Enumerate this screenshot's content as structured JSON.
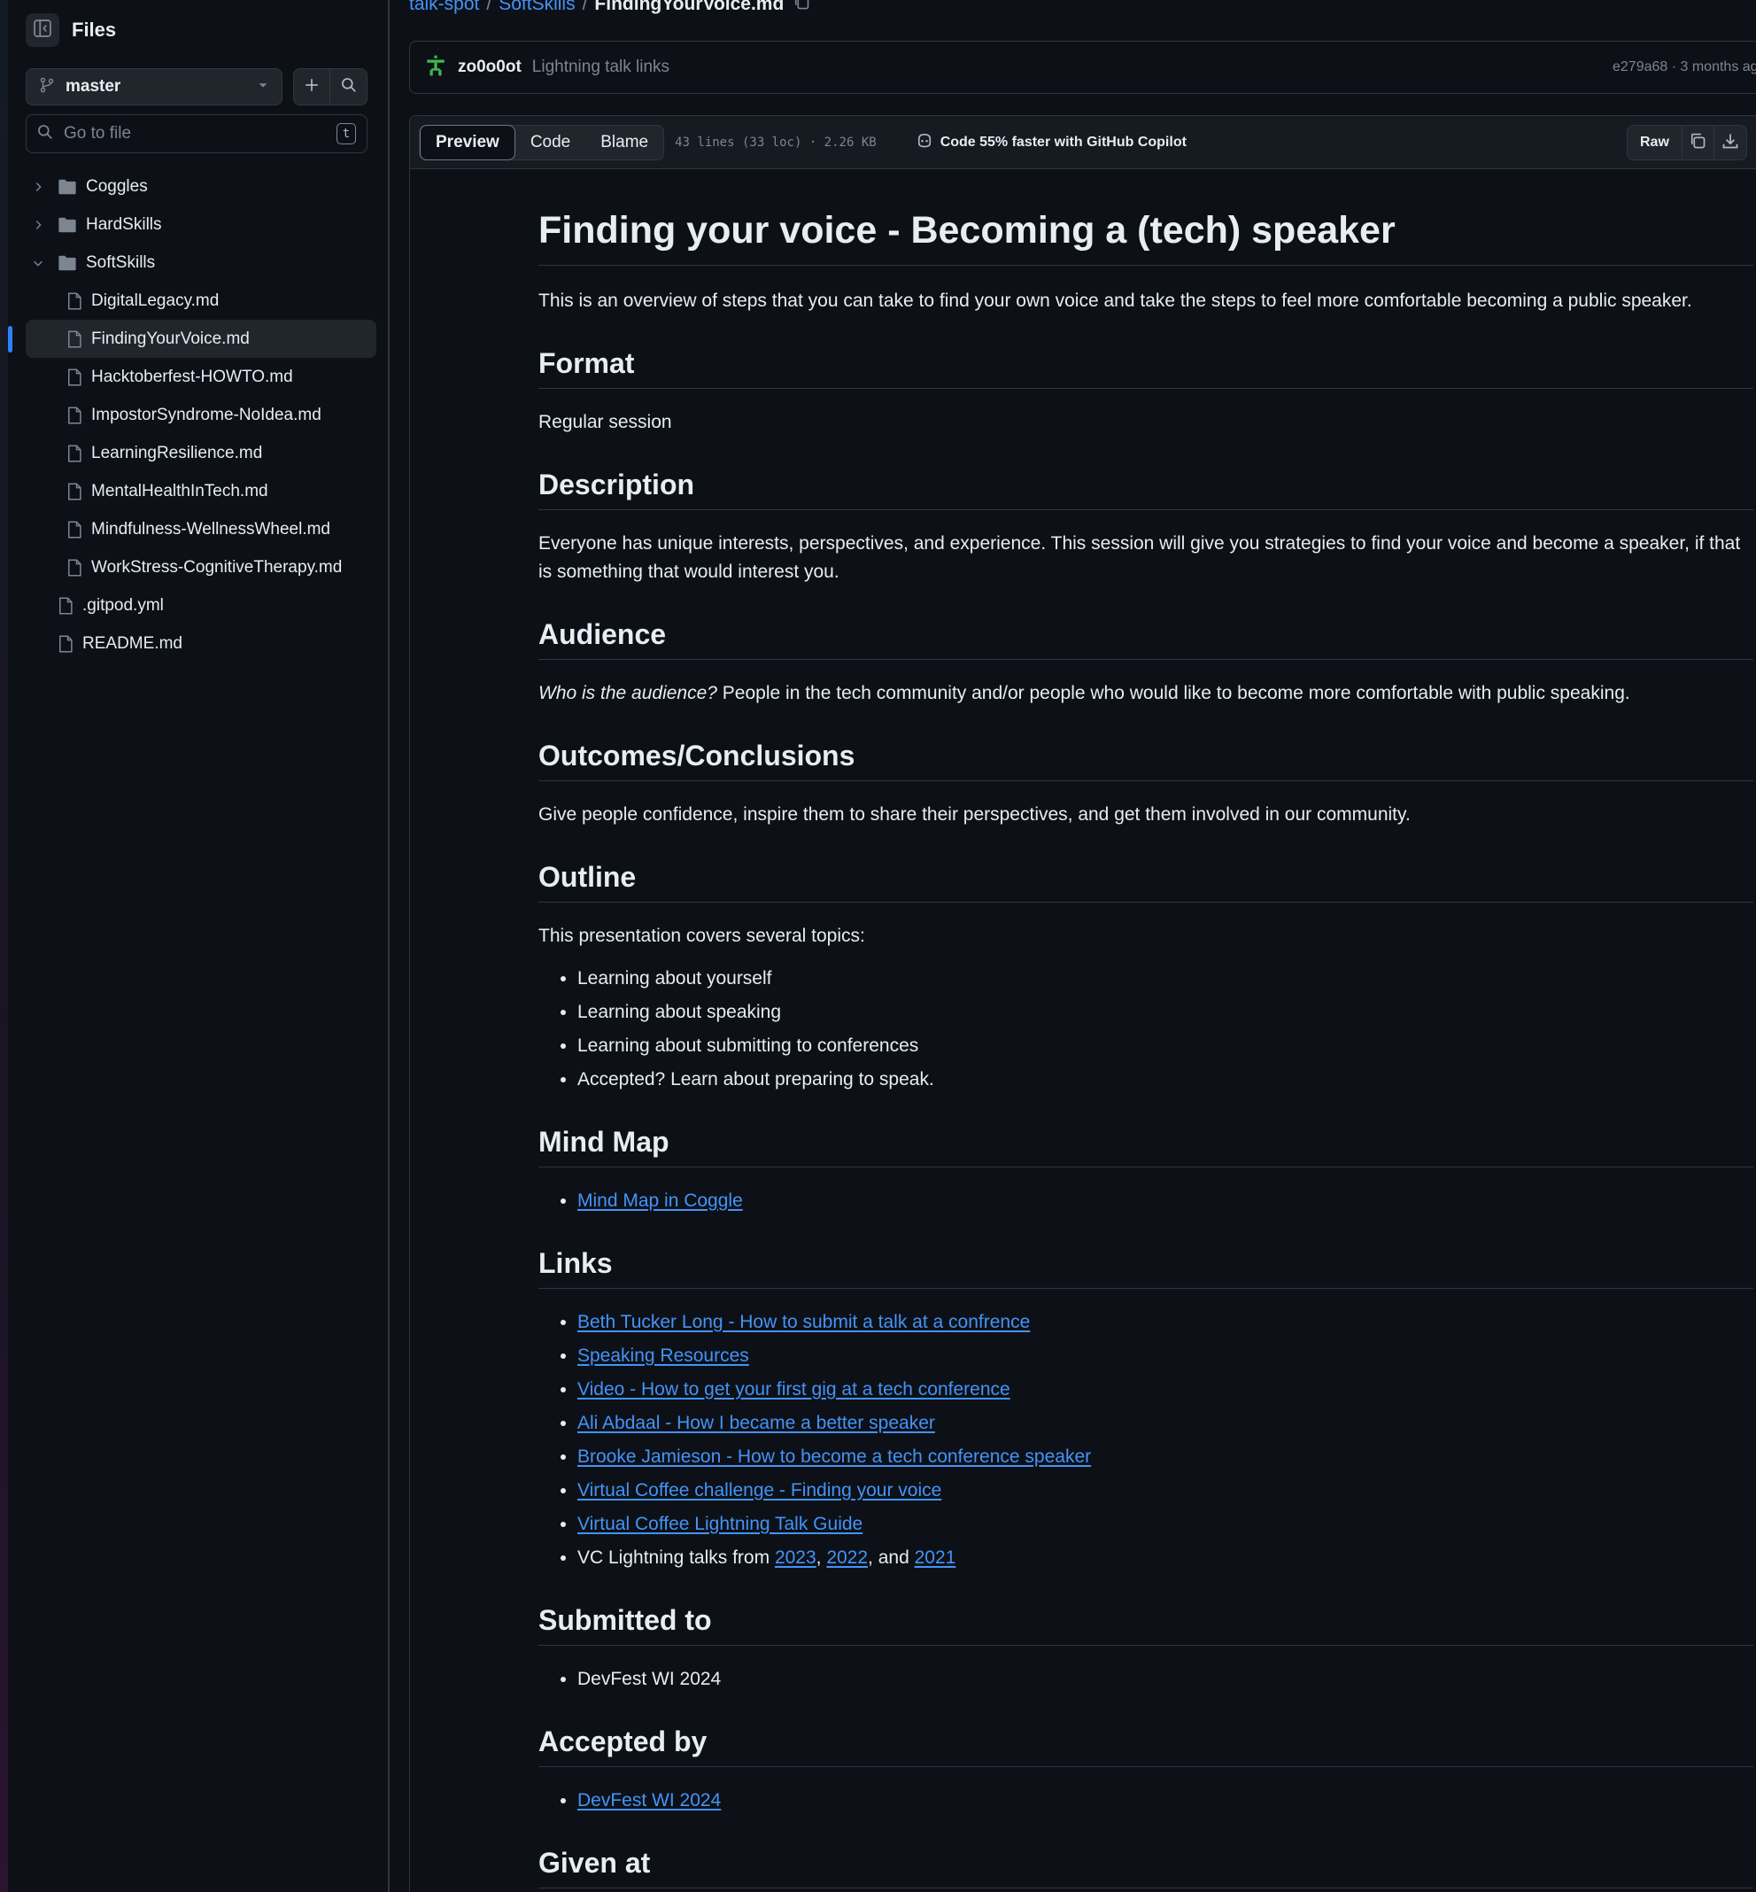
{
  "sidebar": {
    "title": "Files",
    "branch": "master",
    "goto_placeholder": "Go to file",
    "goto_shortcut": "t",
    "tree": [
      {
        "name": "Coggles",
        "type": "folder",
        "expanded": false,
        "level": 0
      },
      {
        "name": "HardSkills",
        "type": "folder",
        "expanded": false,
        "level": 0
      },
      {
        "name": "SoftSkills",
        "type": "folder",
        "expanded": true,
        "level": 0
      },
      {
        "name": "DigitalLegacy.md",
        "type": "file",
        "level": 1
      },
      {
        "name": "FindingYourVoice.md",
        "type": "file",
        "level": 1,
        "active": true
      },
      {
        "name": "Hacktoberfest-HOWTO.md",
        "type": "file",
        "level": 1
      },
      {
        "name": "ImpostorSyndrome-NoIdea.md",
        "type": "file",
        "level": 1
      },
      {
        "name": "LearningResilience.md",
        "type": "file",
        "level": 1
      },
      {
        "name": "MentalHealthInTech.md",
        "type": "file",
        "level": 1
      },
      {
        "name": "Mindfulness-WellnessWheel.md",
        "type": "file",
        "level": 1
      },
      {
        "name": "WorkStress-CognitiveTherapy.md",
        "type": "file",
        "level": 1
      },
      {
        "name": ".gitpod.yml",
        "type": "file",
        "level": 0
      },
      {
        "name": "README.md",
        "type": "file",
        "level": 0
      }
    ]
  },
  "breadcrumb": {
    "repo": "talk-spot",
    "folder": "SoftSkills",
    "file": "FindingYourVoice.md",
    "sep": "/"
  },
  "commit": {
    "author": "zo0o0ot",
    "message": "Lightning talk links",
    "meta": "e279a68 · 3 months ag"
  },
  "file_header": {
    "tabs": [
      "Preview",
      "Code",
      "Blame"
    ],
    "info": "43 lines (33 loc) · 2.26 KB",
    "copilot": "Code 55% faster with GitHub Copilot",
    "raw": "Raw"
  },
  "doc": {
    "title": "Finding your voice - Becoming a (tech) speaker",
    "intro": "This is an overview of steps that you can take to find your own voice and take the steps to feel more comfortable becoming a public speaker.",
    "format": {
      "heading": "Format",
      "text": "Regular session"
    },
    "description": {
      "heading": "Description",
      "text": "Everyone has unique interests, perspectives, and experience. This session will give you strategies to find your voice and become a speaker, if that is something that would interest you."
    },
    "audience": {
      "heading": "Audience",
      "question": "Who is the audience?",
      "text": " People in the tech community and/or people who would like to become more comfortable with public speaking."
    },
    "outcomes": {
      "heading": "Outcomes/Conclusions",
      "text": "Give people confidence, inspire them to share their perspectives, and get them involved in our community."
    },
    "outline": {
      "heading": "Outline",
      "text": "This presentation covers several topics:",
      "items": [
        "Learning about yourself",
        "Learning about speaking",
        "Learning about submitting to conferences",
        "Accepted? Learn about preparing to speak."
      ]
    },
    "mindmap": {
      "heading": "Mind Map",
      "link": "Mind Map in Coggle"
    },
    "links": {
      "heading": "Links",
      "items": [
        "Beth Tucker Long - How to submit a talk at a confrence",
        "Speaking Resources",
        "Video - How to get your first gig at a tech conference",
        "Ali Abdaal - How I became a better speaker",
        "Brooke Jamieson - How to become a tech conference speaker",
        "Virtual Coffee challenge - Finding your voice",
        "Virtual Coffee Lightning Talk Guide"
      ],
      "vc_prefix": "VC Lightning talks from ",
      "vc_2023": "2023",
      "vc_comma": ", ",
      "vc_2022": "2022",
      "vc_and": ", and ",
      "vc_2021": "2021"
    },
    "submitted": {
      "heading": "Submitted to",
      "items": [
        "DevFest WI 2024"
      ]
    },
    "accepted": {
      "heading": "Accepted by",
      "link": "DevFest WI 2024"
    },
    "given": {
      "heading": "Given at"
    }
  },
  "colors": {
    "background": "#0d1117",
    "link": "#4493f8",
    "border": "#30363d",
    "active_indicator": "#2f81f7",
    "avatar": "#3fb950"
  }
}
